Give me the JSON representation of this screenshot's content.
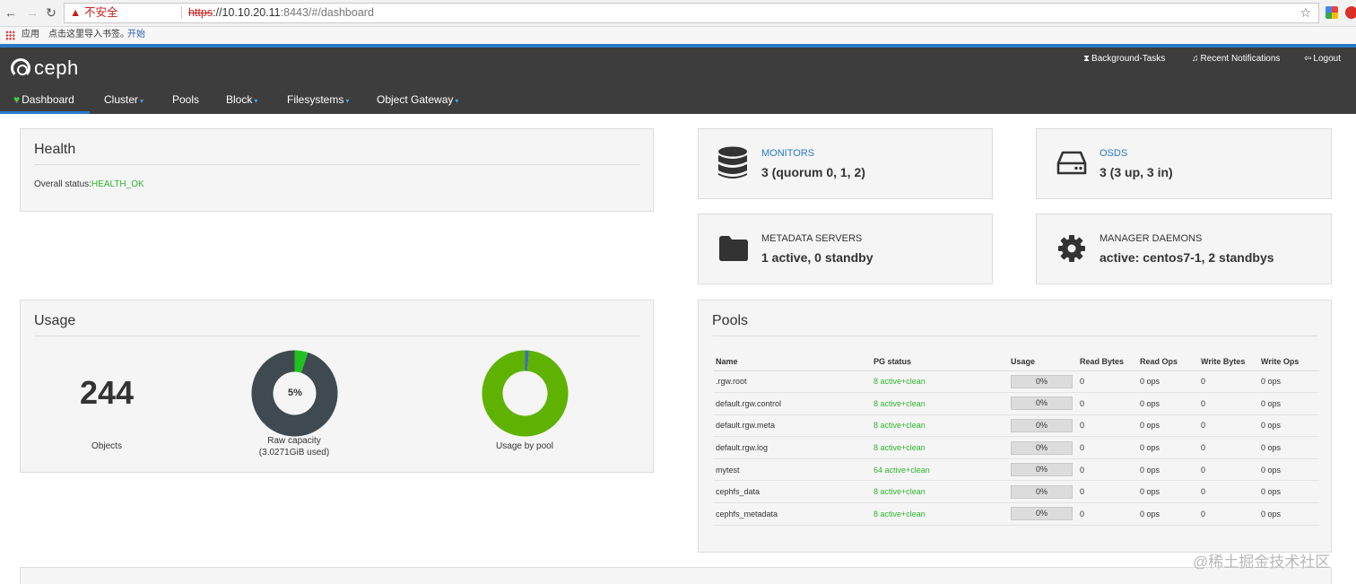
{
  "browser": {
    "insecure_label": "不安全",
    "url_scheme": "https",
    "url_host": "://10.10.20.11",
    "url_path": ":8443/#/dashboard",
    "bookmarks": {
      "apps": "应用",
      "import": "点击这里导入书签。",
      "start": "开始"
    }
  },
  "header": {
    "logo_text": "ceph",
    "top_links": {
      "tasks": "Background-Tasks",
      "notifications": "Recent Notifications",
      "logout": "Logout"
    },
    "tabs": [
      {
        "label": "Dashboard"
      },
      {
        "label": "Cluster"
      },
      {
        "label": "Pools"
      },
      {
        "label": "Block"
      },
      {
        "label": "Filesystems"
      },
      {
        "label": "Object Gateway"
      }
    ]
  },
  "health": {
    "title": "Health",
    "status_label": "Overall status:",
    "status_value": "HEALTH_OK"
  },
  "monitors": {
    "label": "MONITORS",
    "value": "3 (quorum 0, 1, 2)"
  },
  "osds": {
    "label": "OSDS",
    "value": "3 (3 up, 3 in)"
  },
  "mds": {
    "label": "METADATA SERVERS",
    "value": "1 active, 0 standby"
  },
  "mgr": {
    "label": "MANAGER DAEMONS",
    "value": "active: centos7-1, 2 standbys"
  },
  "usage": {
    "title": "Usage",
    "objects_count": "244",
    "objects_label": "Objects",
    "raw_pct_label": "5%",
    "raw_used_fraction": 0.05,
    "raw_caption_1": "Raw capacity",
    "raw_caption_2": "(3.0271GiB used)",
    "pool_caption": "Usage by pool",
    "pool_slices": [
      0.015,
      0.985
    ]
  },
  "pools": {
    "title": "Pools",
    "columns": [
      "Name",
      "PG status",
      "Usage",
      "Read Bytes",
      "Read Ops",
      "Write Bytes",
      "Write Ops"
    ],
    "rows": [
      {
        "name": ".rgw.root",
        "pg": "8 active+clean",
        "usage": "0%",
        "rb": "0",
        "ro": "0 ops",
        "wb": "0",
        "wo": "0 ops"
      },
      {
        "name": "default.rgw.control",
        "pg": "8 active+clean",
        "usage": "0%",
        "rb": "0",
        "ro": "0 ops",
        "wb": "0",
        "wo": "0 ops"
      },
      {
        "name": "default.rgw.meta",
        "pg": "8 active+clean",
        "usage": "0%",
        "rb": "0",
        "ro": "0 ops",
        "wb": "0",
        "wo": "0 ops"
      },
      {
        "name": "default.rgw.log",
        "pg": "8 active+clean",
        "usage": "0%",
        "rb": "0",
        "ro": "0 ops",
        "wb": "0",
        "wo": "0 ops"
      },
      {
        "name": "mytest",
        "pg": "64 active+clean",
        "usage": "0%",
        "rb": "0",
        "ro": "0 ops",
        "wb": "0",
        "wo": "0 ops"
      },
      {
        "name": "cephfs_data",
        "pg": "8 active+clean",
        "usage": "0%",
        "rb": "0",
        "ro": "0 ops",
        "wb": "0",
        "wo": "0 ops"
      },
      {
        "name": "cephfs_metadata",
        "pg": "8 active+clean",
        "usage": "0%",
        "rb": "0",
        "ro": "0 ops",
        "wb": "0",
        "wo": "0 ops"
      }
    ]
  },
  "watermark": "@稀土掘金技术社区",
  "colors": {
    "accent": "#2a7ac9",
    "ok": "#2fb52f",
    "donut_dark": "#3f4a50",
    "donut_green": "#5fb200"
  }
}
